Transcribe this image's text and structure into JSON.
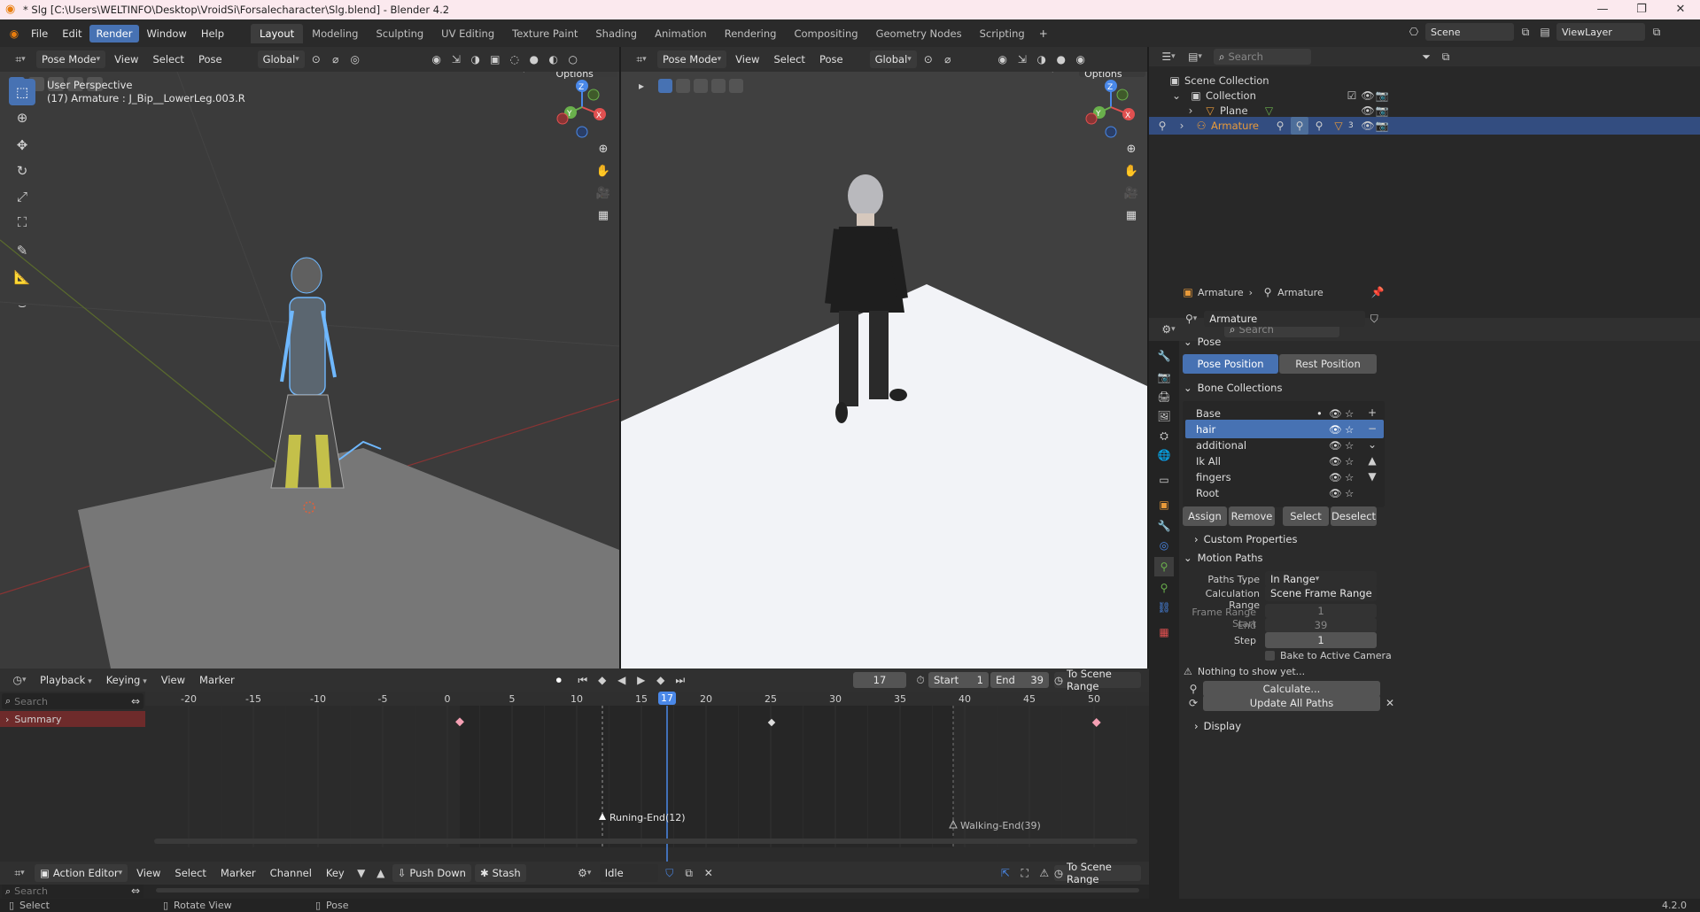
{
  "window": {
    "title": "* Slg [C:\\Users\\WELTINFO\\Desktop\\VroidSi\\Forsalecharacter\\Slg.blend] - Blender 4.2",
    "minimize": "—",
    "maximize": "❐",
    "close": "✕"
  },
  "menu": [
    "File",
    "Edit",
    "Render",
    "Window",
    "Help"
  ],
  "workspaces": [
    "Layout",
    "Modeling",
    "Sculpting",
    "UV Editing",
    "Texture Paint",
    "Shading",
    "Animation",
    "Rendering",
    "Compositing",
    "Geometry Nodes",
    "Scripting"
  ],
  "scene_name": "Scene",
  "view_layer": "ViewLayer",
  "viewport_left": {
    "mode": "Pose Mode",
    "view": "View",
    "select": "Select",
    "pose": "Pose",
    "orientation": "Global",
    "pose_options": "Pose Options",
    "overlay_title": "User Perspective",
    "overlay_sub": "(17) Armature : J_Bip__LowerLeg.003.R"
  },
  "viewport_right": {
    "mode": "Pose Mode",
    "view": "View",
    "select": "Select",
    "pose": "Pose",
    "orientation": "Global",
    "pose_options": "Pose Options"
  },
  "gizmo": {
    "x": "X",
    "y": "Y",
    "z": "Z"
  },
  "outliner": {
    "search_placeholder": "Search",
    "rows": [
      "Scene Collection",
      "Collection",
      "Plane",
      "Armature"
    ],
    "armature_badge": "3"
  },
  "properties": {
    "search_placeholder": "Search",
    "breadcrumb": [
      "Armature",
      "Armature"
    ],
    "data_name": "Armature",
    "pose_header": "Pose",
    "pose_position": "Pose Position",
    "rest_position": "Rest Position",
    "bone_collections_header": "Bone Collections",
    "bone_collections": [
      "Base",
      "hair",
      "additional",
      "Ik All",
      "fingers",
      "Root"
    ],
    "selected_collection": "hair",
    "assign": "Assign",
    "remove": "Remove",
    "select": "Select",
    "deselect": "Deselect",
    "custom_properties": "Custom Properties",
    "motion_paths": "Motion Paths",
    "paths_type_label": "Paths Type",
    "paths_type": "In Range",
    "calc_range_label": "Calculation Range",
    "calc_range": "Scene Frame Range",
    "frame_range_start_label": "Frame Range Start",
    "frame_range_start": "1",
    "end_label": "End",
    "end": "39",
    "step_label": "Step",
    "step": "1",
    "bake_to_camera": "Bake to Active Camera",
    "nothing_to_show": "Nothing to show yet...",
    "calculate": "Calculate...",
    "update_all_paths": "Update All Paths",
    "display": "Display"
  },
  "timeline": {
    "playback": "Playback",
    "keying": "Keying",
    "view": "View",
    "marker": "Marker",
    "current_frame": "17",
    "start_label": "Start",
    "start": "1",
    "end_label": "End",
    "end": "39",
    "to_scene_range": "To Scene Range",
    "search_placeholder": "Search",
    "summary": "Summary",
    "frame_labels": [
      "-20",
      "-15",
      "-10",
      "-5",
      "0",
      "5",
      "10",
      "15",
      "17",
      "20",
      "25",
      "30",
      "35",
      "40",
      "45",
      "50"
    ],
    "markers": [
      "Runing-End(12)",
      "Walking-End(39)"
    ]
  },
  "action_editor": {
    "mode": "Action Editor",
    "view": "View",
    "select": "Select",
    "marker": "Marker",
    "channel": "Channel",
    "key": "Key",
    "push_down": "Push Down",
    "stash": "Stash",
    "action": "Idle",
    "to_scene_range": "To Scene Range",
    "search_placeholder": "Search"
  },
  "status": {
    "select": "Select",
    "rotate": "Rotate View",
    "pose": "Pose",
    "version": "4.2.0"
  }
}
